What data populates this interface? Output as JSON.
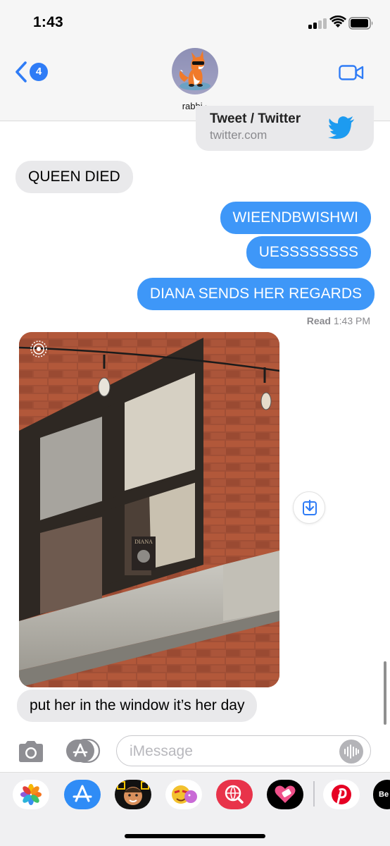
{
  "status_bar": {
    "time": "1:43"
  },
  "header": {
    "back_count": "4",
    "contact_name": "rabbi",
    "name_chevron": "›"
  },
  "link_preview": {
    "title": "Tweet / Twitter",
    "domain": "twitter.com"
  },
  "messages": [
    {
      "direction": "incoming",
      "text": "QUEEN DIED"
    },
    {
      "direction": "outgoing",
      "text": "WIEENDBWISHWI"
    },
    {
      "direction": "outgoing",
      "text": "UESSSSSSSS"
    },
    {
      "direction": "outgoing",
      "text": "DIANA SENDS HER REGARDS"
    },
    {
      "direction": "incoming",
      "text": "put her in the window it’s her day"
    }
  ],
  "read_receipt": {
    "label": "Read",
    "time": "1:43 PM"
  },
  "photo": {
    "poster_text": "DIANA",
    "description_icon": "live-photo-icon"
  },
  "input": {
    "placeholder": "iMessage"
  },
  "app_drawer": {
    "apps": [
      "photos-app-icon",
      "app-store-icon",
      "memoji-icon",
      "animoji-icon",
      "web-images-icon",
      "heart-app-icon",
      "pinterest-icon",
      "bereal-icon"
    ],
    "bereal_label": "Be"
  },
  "colors": {
    "outgoing_bubble": "#3e97f8",
    "incoming_bubble": "#e9e9eb",
    "accent": "#2f7cf6"
  }
}
